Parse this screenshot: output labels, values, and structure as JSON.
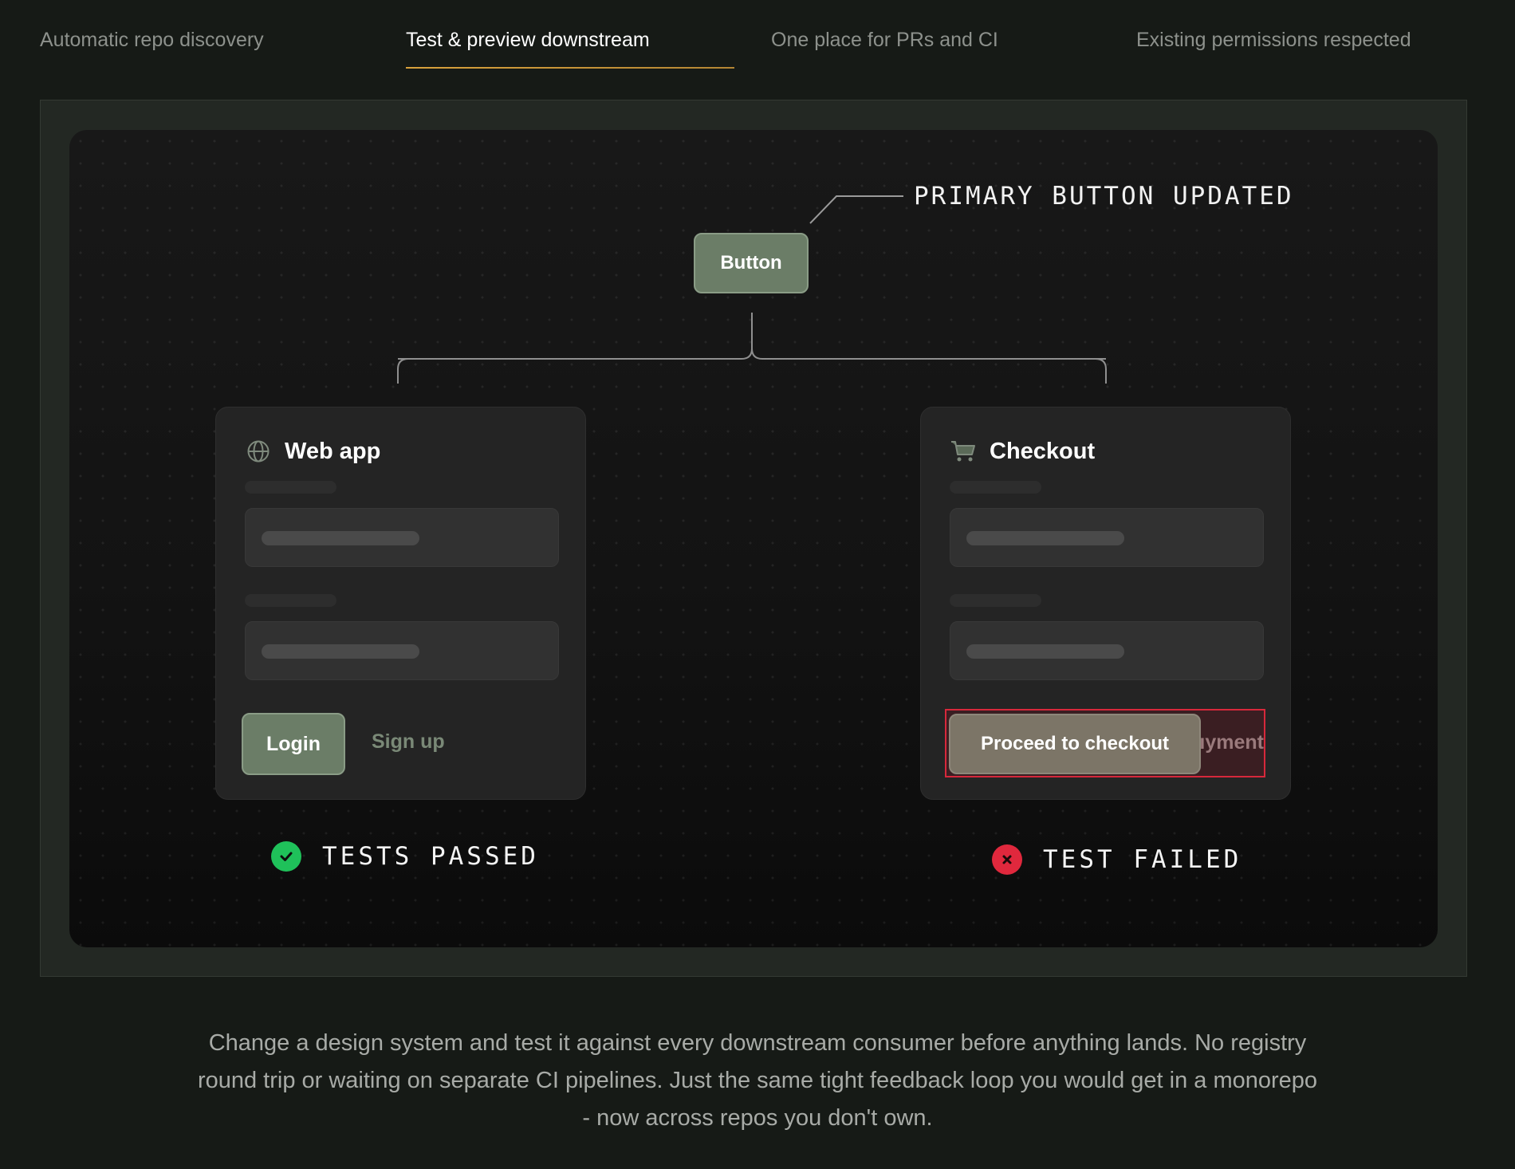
{
  "tabs": [
    {
      "label": "Automatic repo discovery",
      "active": false
    },
    {
      "label": "Test & preview downstream",
      "active": true
    },
    {
      "label": "One place for PRs and CI",
      "active": false
    },
    {
      "label": "Existing permissions respected",
      "active": false
    }
  ],
  "colors": {
    "accent_underline": "#d9a23c",
    "button_green": "#6b7d67",
    "pass_green": "#1fc15a",
    "fail_red": "#e0283d",
    "fail_outline": "#d7283b"
  },
  "diagram": {
    "callout": "PRIMARY BUTTON UPDATED",
    "source_button": "Button",
    "cards": {
      "web": {
        "icon": "globe-icon",
        "title": "Web app",
        "primary_button": "Login",
        "secondary_link": "Sign up",
        "status": "TESTS PASSED",
        "status_icon": "check-circle-icon"
      },
      "checkout": {
        "icon": "cart-icon",
        "title": "Checkout",
        "primary_button": "Proceed to checkout",
        "overflow_text": "ıyment",
        "status": "TEST FAILED",
        "status_icon": "x-circle-icon"
      }
    }
  },
  "description": "Change a design system and test it against every downstream consumer before anything lands. No registry round trip or waiting on separate CI pipelines. Just the same tight feedback loop you would get in a monorepo - now across repos you don't own."
}
